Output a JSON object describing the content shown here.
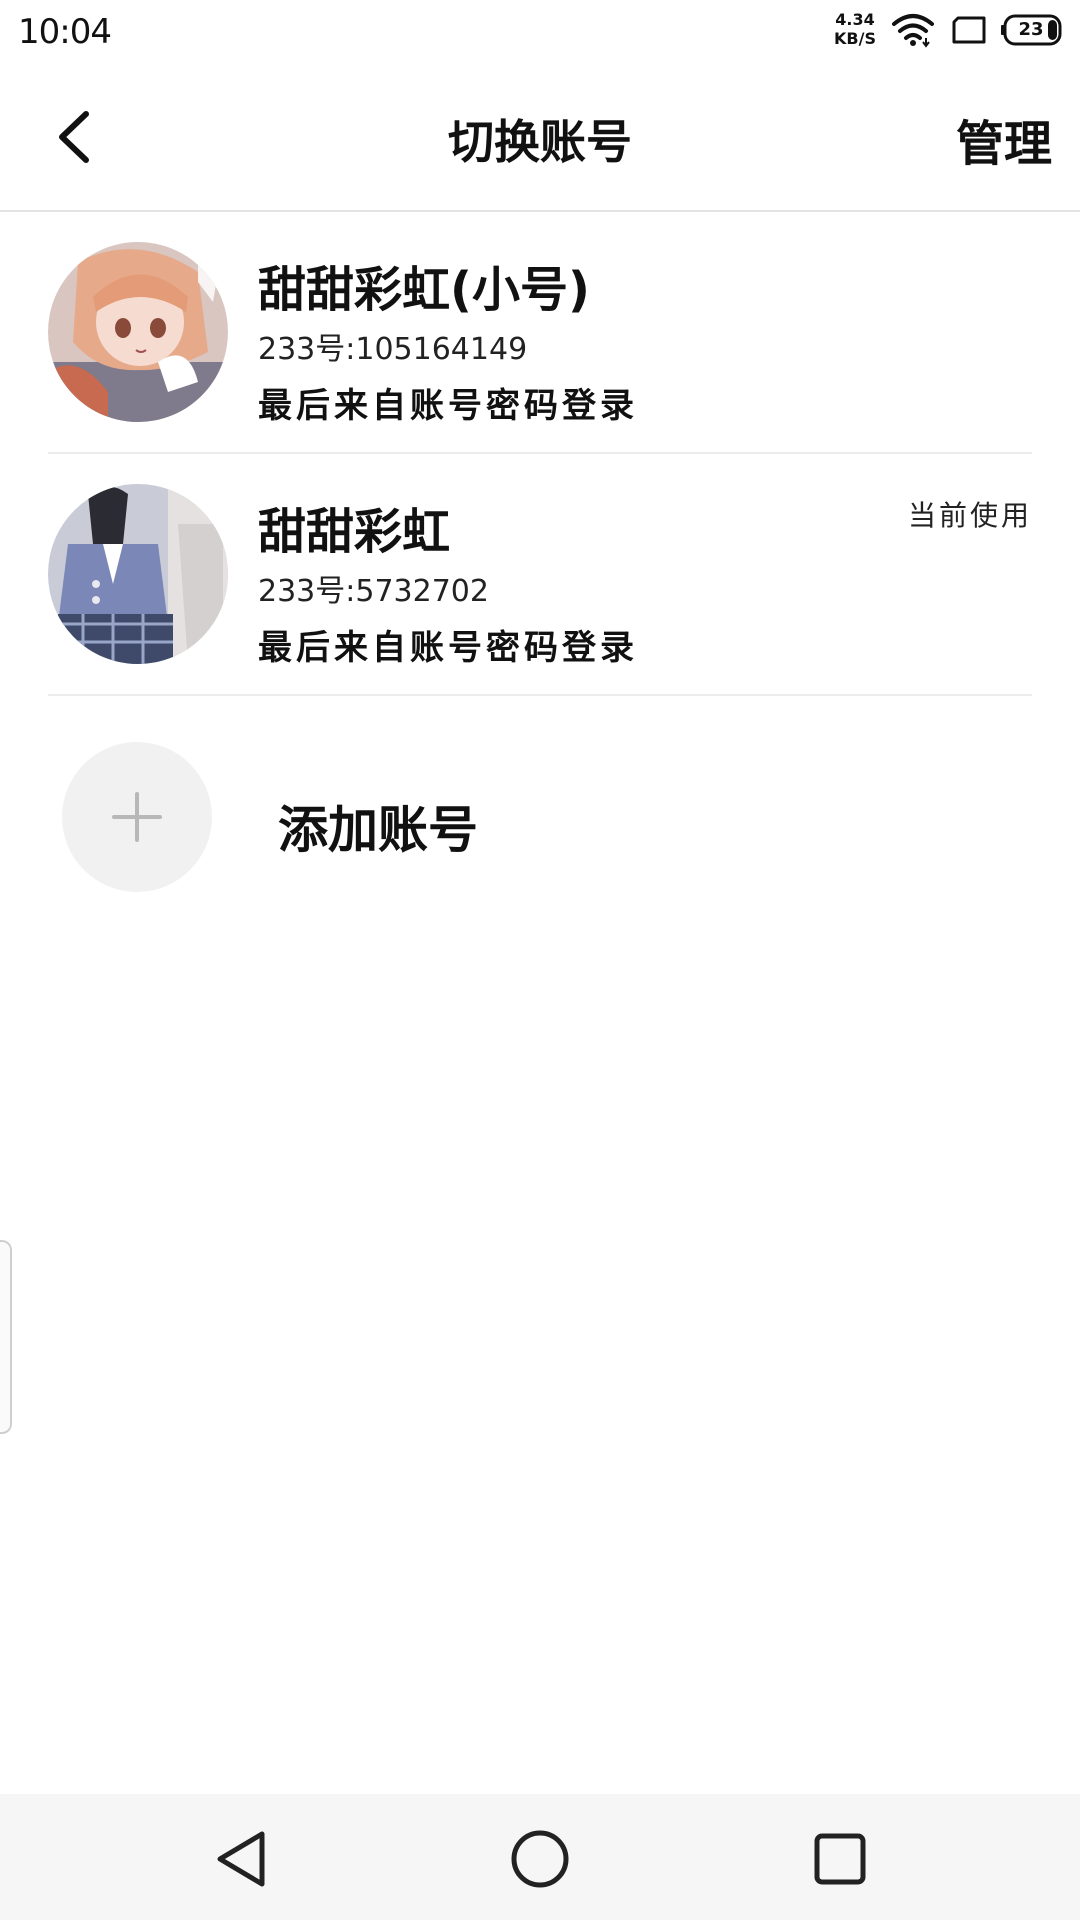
{
  "status_bar": {
    "time": "10:04",
    "net_speed_value": "4.34",
    "net_speed_unit": "KB/S",
    "battery": "23",
    "icons": [
      "wifi-icon",
      "sim-card-icon",
      "battery-icon"
    ]
  },
  "header": {
    "title": "切换账号",
    "manage_label": "管理",
    "back_icon": "back-arrow-icon"
  },
  "accounts": [
    {
      "name": "甜甜彩虹(小号)",
      "id_text": "233号:105164149",
      "login_method": "最后来自账号密码登录",
      "current_tag": ""
    },
    {
      "name": "甜甜彩虹",
      "id_text": "233号:5732702",
      "login_method": "最后来自账号密码登录",
      "current_tag": "当前使用"
    }
  ],
  "add_account": {
    "label": "添加账号",
    "icon": "plus-icon"
  },
  "system_nav": {
    "icons": [
      "back-triangle-icon",
      "home-circle-icon",
      "recents-square-icon"
    ]
  },
  "colors": {
    "background": "#ffffff",
    "divider": "#ececec",
    "add_circle": "#f1f1f1",
    "nav_bar": "#f6f6f6"
  }
}
